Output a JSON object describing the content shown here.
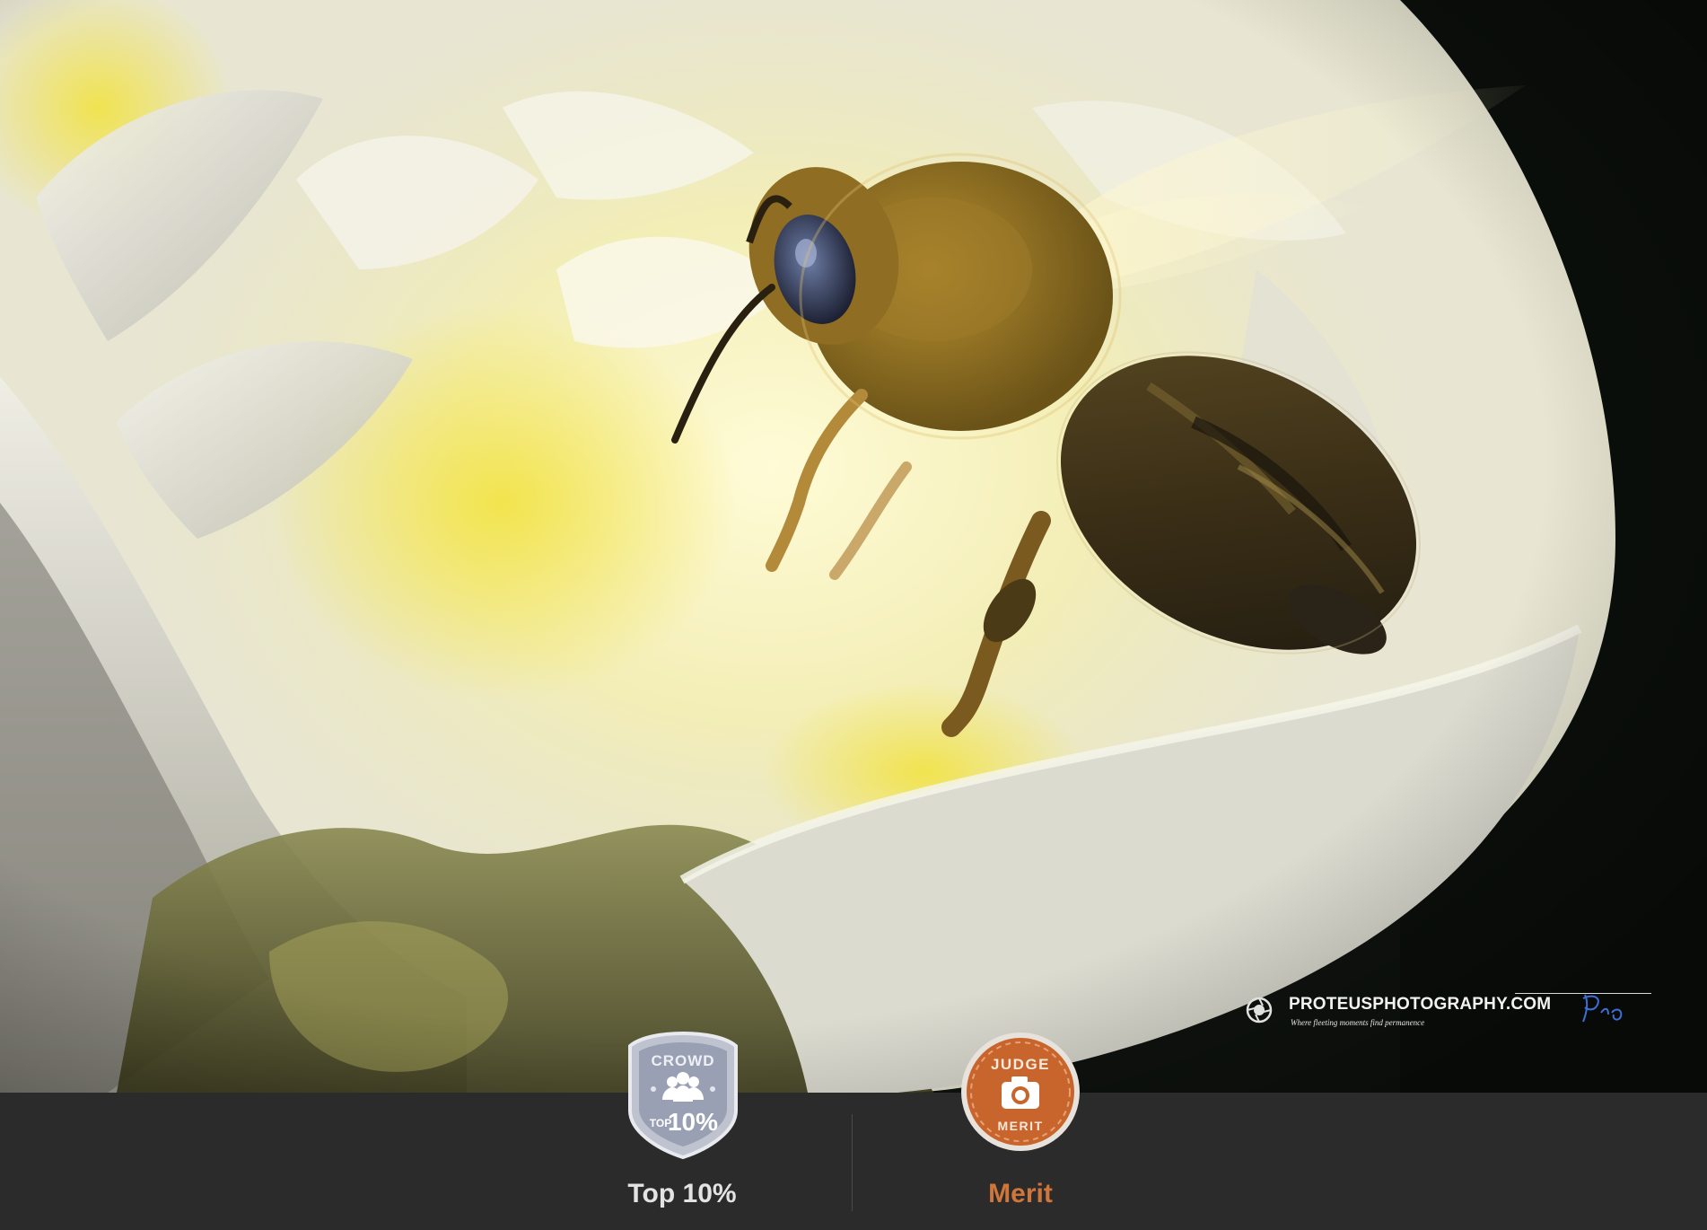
{
  "photo": {
    "subject": "honeybee-over-white-flower"
  },
  "watermark": {
    "site": "PROTEUSPHOTOGRAPHY.COM",
    "tagline": "Where fleeting moments find permanence",
    "signature": "Pro"
  },
  "awards": {
    "crowd": {
      "badge_top": "CROWD",
      "badge_small": "TOP",
      "badge_big": "10%",
      "label": "Top 10%",
      "color": "#e3e3e3"
    },
    "judge": {
      "badge_top": "JUDGE",
      "badge_bottom": "MERIT",
      "label": "Merit",
      "color": "#d0763a"
    }
  },
  "icons": {
    "crowd": "group-people-icon",
    "judge": "camera-icon",
    "logo": "aperture-logo-icon"
  }
}
